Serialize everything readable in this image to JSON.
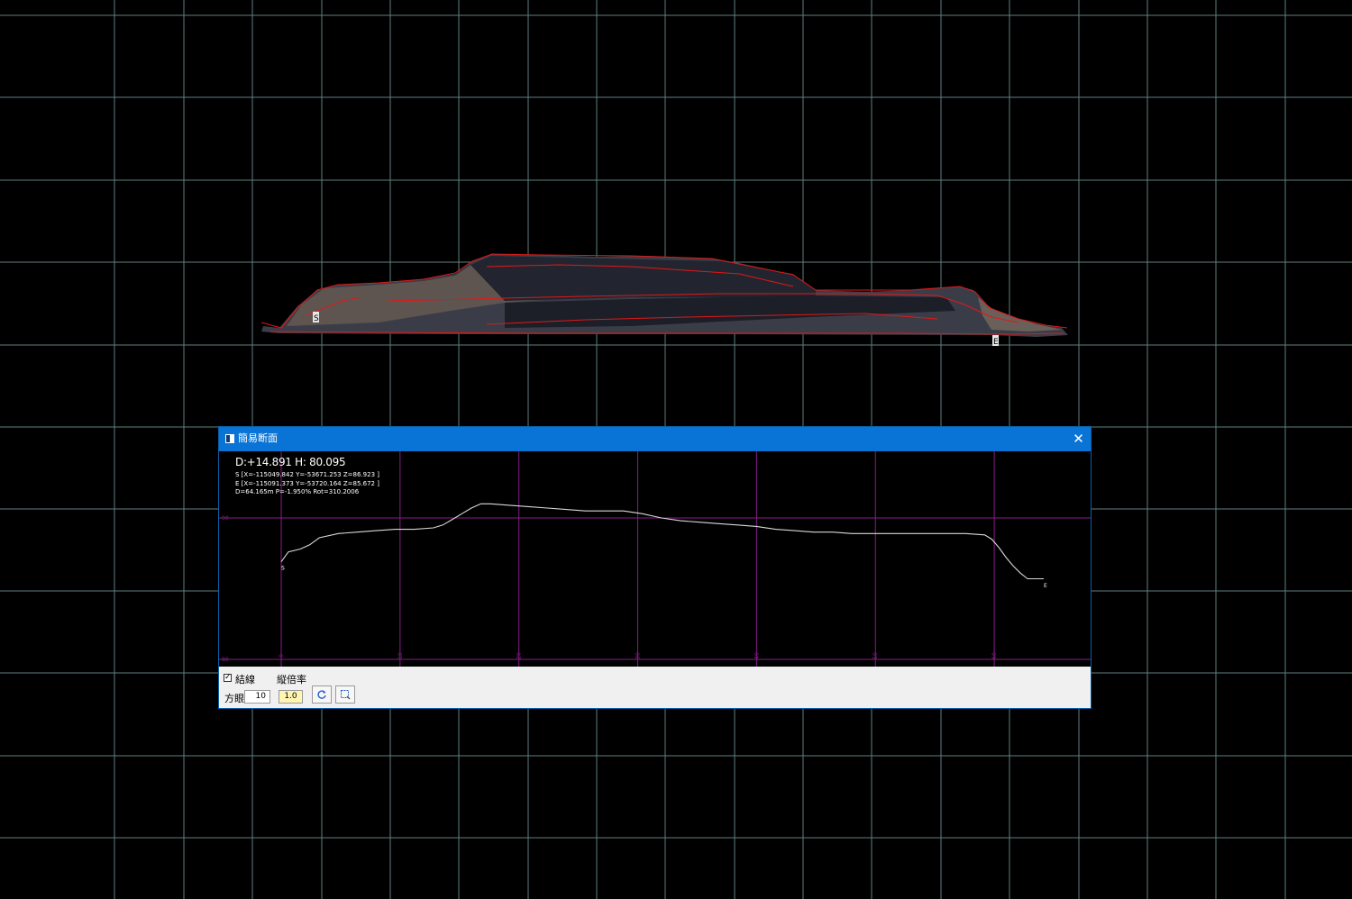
{
  "window": {
    "title": "簡易断面",
    "close_glyph": "✕",
    "icon": "window-icon"
  },
  "readout": {
    "distance_height": "D:+14.891 H: 80.095",
    "start_point": "S [X=-115049.842 Y=-53671.253 Z=86.923 ]",
    "end_point": "E [X=-115091.373 Y=-53720.164 Z=85.672 ]",
    "stats": "D=64.165m P=-1.950% Rot=310.2006"
  },
  "controls": {
    "connect_lines_checked": true,
    "connect_lines_label": "結線",
    "vertical_scale_label": "縦倍率",
    "grid_label": "方眼",
    "grid_value": "10",
    "vertical_scale_value": "1.0",
    "refresh_icon": "refresh-icon",
    "window_icon": "window-select-icon"
  },
  "colors": {
    "background": "#000000",
    "background_grid": "#5f7f7f",
    "profile_line": "#d8d8d8",
    "profile_grid": "#8a1c8a",
    "title_bar": "#0a74d6",
    "scale_field": "#fff5b0",
    "point_cloud_outline": "#e01818"
  },
  "chart_data": {
    "type": "line",
    "title": "",
    "xlabel": "",
    "ylabel": "",
    "xlim": [
      0,
      64.165
    ],
    "ylim": [
      80,
      90
    ],
    "x_ticks": [
      0,
      10,
      20,
      30,
      40,
      50,
      60
    ],
    "y_ticks": [
      80,
      90
    ],
    "markers": [
      {
        "label": "S",
        "x": 0,
        "y": 86.923
      },
      {
        "label": "E",
        "x": 64.165,
        "y": 85.672
      }
    ],
    "series": [
      {
        "x": [
          0,
          0.6,
          1.6,
          2.4,
          3.2,
          4.8,
          6.4,
          8.0,
          9.6,
          11.2,
          12.8,
          13.6,
          14.4,
          15.2,
          16.0,
          16.8,
          17.6,
          19.2,
          20.8,
          22.4,
          24.0,
          25.6,
          27.2,
          28.8,
          30.4,
          32.0,
          33.6,
          35.2,
          36.8,
          38.4,
          40.0,
          41.6,
          43.2,
          44.8,
          46.4,
          48.0,
          49.6,
          51.2,
          52.8,
          54.4,
          56.0,
          57.6,
          59.2,
          59.8,
          60.4,
          61.0,
          61.6,
          62.2,
          62.8,
          63.4,
          64.165
        ],
        "y": [
          86.9,
          87.6,
          87.8,
          88.1,
          88.6,
          88.9,
          89.0,
          89.1,
          89.2,
          89.2,
          89.3,
          89.5,
          89.9,
          90.3,
          90.7,
          91.0,
          91.0,
          90.9,
          90.8,
          90.7,
          90.6,
          90.5,
          90.5,
          90.5,
          90.3,
          90.0,
          89.8,
          89.7,
          89.6,
          89.5,
          89.4,
          89.2,
          89.1,
          89.0,
          89.0,
          88.9,
          88.9,
          88.9,
          88.9,
          88.9,
          88.9,
          88.9,
          88.8,
          88.5,
          87.9,
          87.2,
          86.6,
          86.1,
          85.7,
          85.7,
          85.7
        ]
      }
    ],
    "grid": true
  }
}
